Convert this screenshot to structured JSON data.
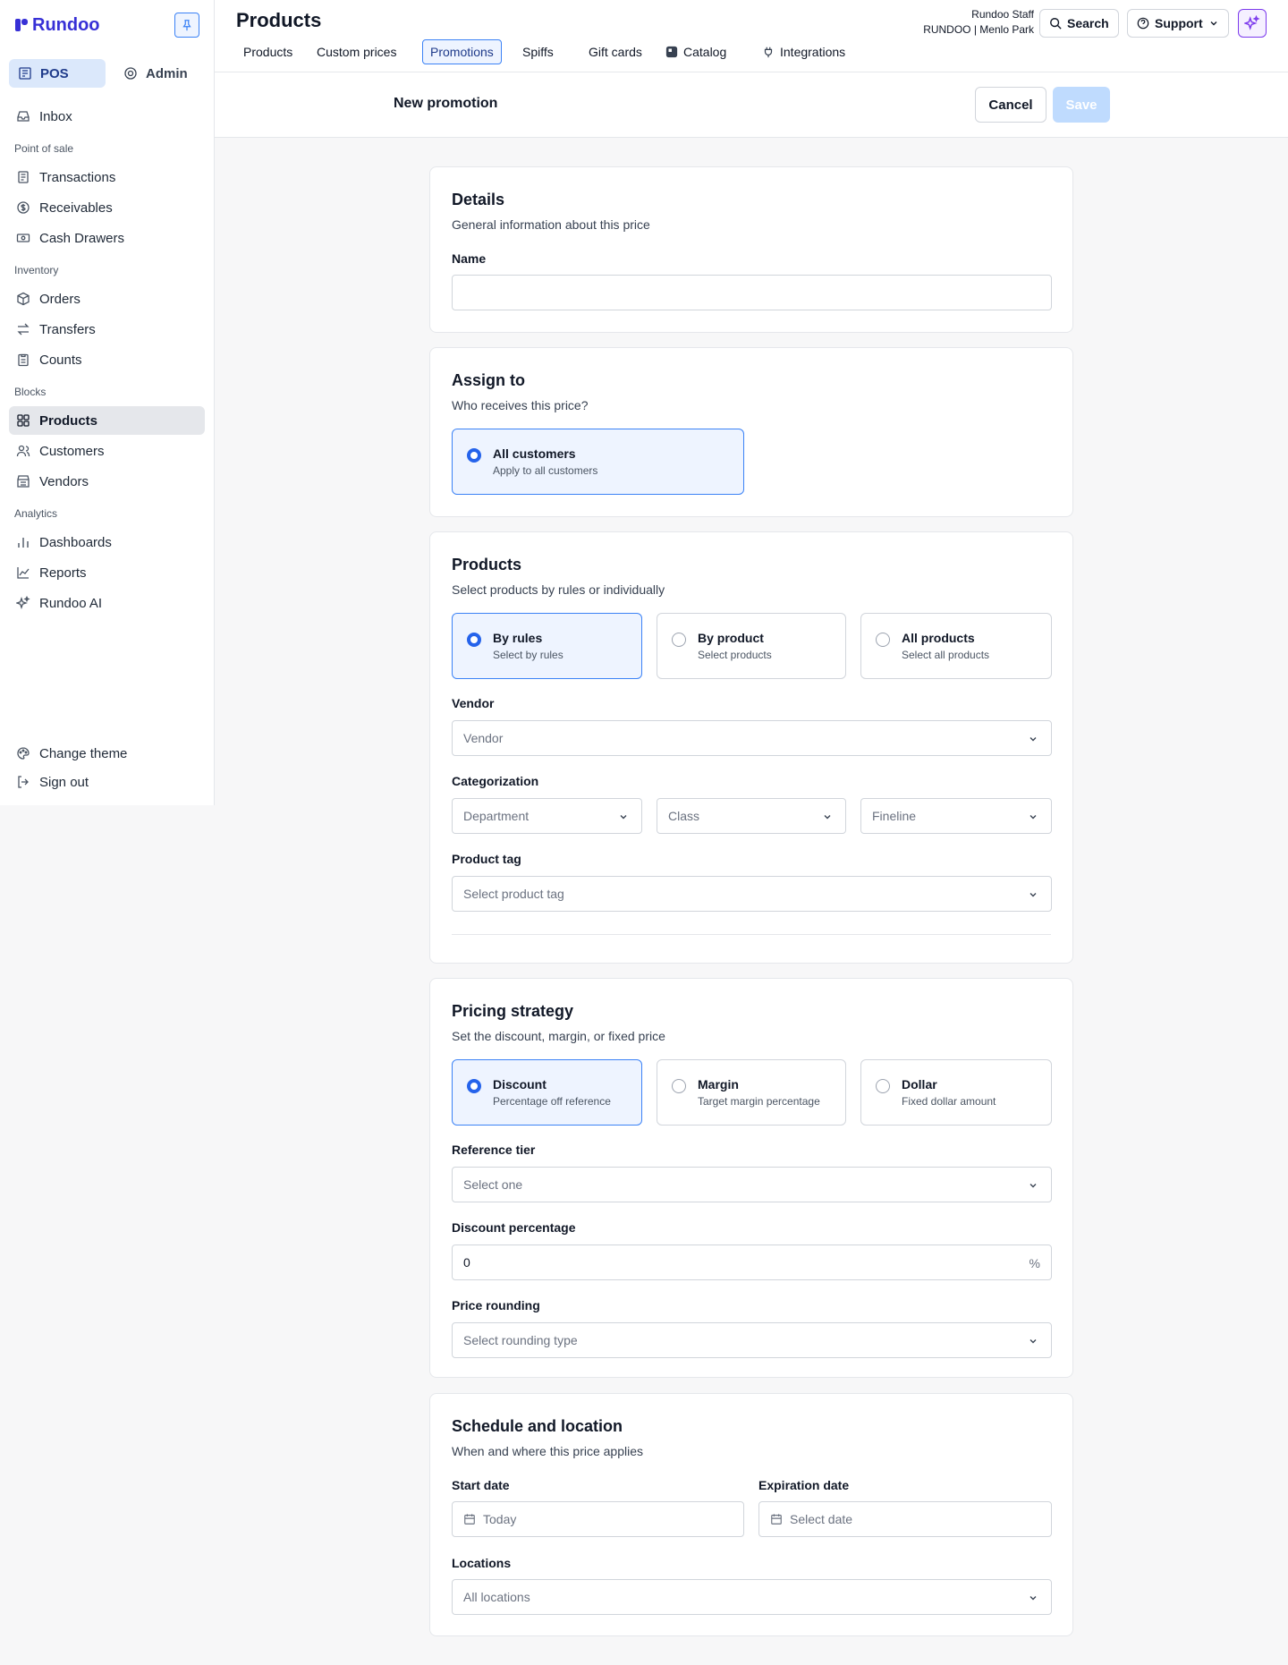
{
  "app": {
    "brand": "Rundoo"
  },
  "mode": {
    "pos": "POS",
    "admin": "Admin"
  },
  "sidebar": {
    "inbox": "Inbox",
    "sections": {
      "pos": "Point of sale",
      "inventory": "Inventory",
      "blocks": "Blocks",
      "analytics": "Analytics"
    },
    "items": {
      "transactions": "Transactions",
      "receivables": "Receivables",
      "cash_drawers": "Cash Drawers",
      "orders": "Orders",
      "transfers": "Transfers",
      "counts": "Counts",
      "products": "Products",
      "customers": "Customers",
      "vendors": "Vendors",
      "dashboards": "Dashboards",
      "reports": "Reports",
      "rundoo_ai": "Rundoo AI"
    },
    "footer": {
      "change_theme": "Change theme",
      "sign_out": "Sign out"
    }
  },
  "header": {
    "title": "Products",
    "tabs": [
      "Products",
      "Custom prices",
      "Promotions",
      "Spiffs",
      "Gift cards",
      "Catalog",
      "Integrations"
    ],
    "active_tab": "Promotions",
    "user": {
      "name": "Rundoo Staff",
      "store": "RUNDOO | Menlo Park"
    },
    "search": "Search",
    "support": "Support"
  },
  "form": {
    "title": "New promotion",
    "cancel": "Cancel",
    "save": "Save",
    "details": {
      "title": "Details",
      "subtitle": "General information about this price",
      "name_label": "Name",
      "name_value": ""
    },
    "assign": {
      "title": "Assign to",
      "subtitle": "Who receives this price?",
      "option": {
        "title": "All customers",
        "sub": "Apply to all customers",
        "selected": true
      }
    },
    "products": {
      "title": "Products",
      "subtitle": "Select products by rules or individually",
      "options": [
        {
          "title": "By rules",
          "sub": "Select by rules",
          "selected": true
        },
        {
          "title": "By product",
          "sub": "Select products",
          "selected": false
        },
        {
          "title": "All products",
          "sub": "Select all products",
          "selected": false
        }
      ],
      "vendor_label": "Vendor",
      "vendor_placeholder": "Vendor",
      "categorization_label": "Categorization",
      "department": "Department",
      "class": "Class",
      "fineline": "Fineline",
      "tag_label": "Product tag",
      "tag_placeholder": "Select product tag"
    },
    "pricing": {
      "title": "Pricing strategy",
      "subtitle": "Set the discount, margin, or fixed price",
      "options": [
        {
          "title": "Discount",
          "sub": "Percentage off reference",
          "selected": true
        },
        {
          "title": "Margin",
          "sub": "Target margin percentage",
          "selected": false
        },
        {
          "title": "Dollar",
          "sub": "Fixed dollar amount",
          "selected": false
        }
      ],
      "reference_label": "Reference tier",
      "reference_placeholder": "Select one",
      "discount_label": "Discount percentage",
      "discount_value": "0",
      "discount_suffix": "%",
      "rounding_label": "Price rounding",
      "rounding_placeholder": "Select rounding type"
    },
    "schedule": {
      "title": "Schedule and location",
      "subtitle": "When and where this price applies",
      "start_label": "Start date",
      "start_value": "Today",
      "expiration_label": "Expiration date",
      "expiration_placeholder": "Select date",
      "locations_label": "Locations",
      "locations_value": "All locations"
    }
  },
  "colors": {
    "accent": "#2563eb",
    "brand": "#3730d6",
    "selected_bg": "#eef4ff",
    "save_disabled": "#bfdbfe",
    "ai": "#7c3aed"
  },
  "icons": [
    "logo-icon",
    "pin-icon",
    "pos-icon",
    "gear-icon",
    "inbox-icon",
    "receipt-icon",
    "dollar-circle-icon",
    "cash-icon",
    "box-icon",
    "transfer-icon",
    "clipboard-icon",
    "grid-icon",
    "users-icon",
    "store-icon",
    "bar-chart-icon",
    "line-chart-icon",
    "sparkle-icon",
    "palette-icon",
    "sign-out-icon",
    "search-icon",
    "help-icon",
    "chevron-down-icon",
    "plug-icon",
    "catalog-icon",
    "calendar-icon"
  ]
}
